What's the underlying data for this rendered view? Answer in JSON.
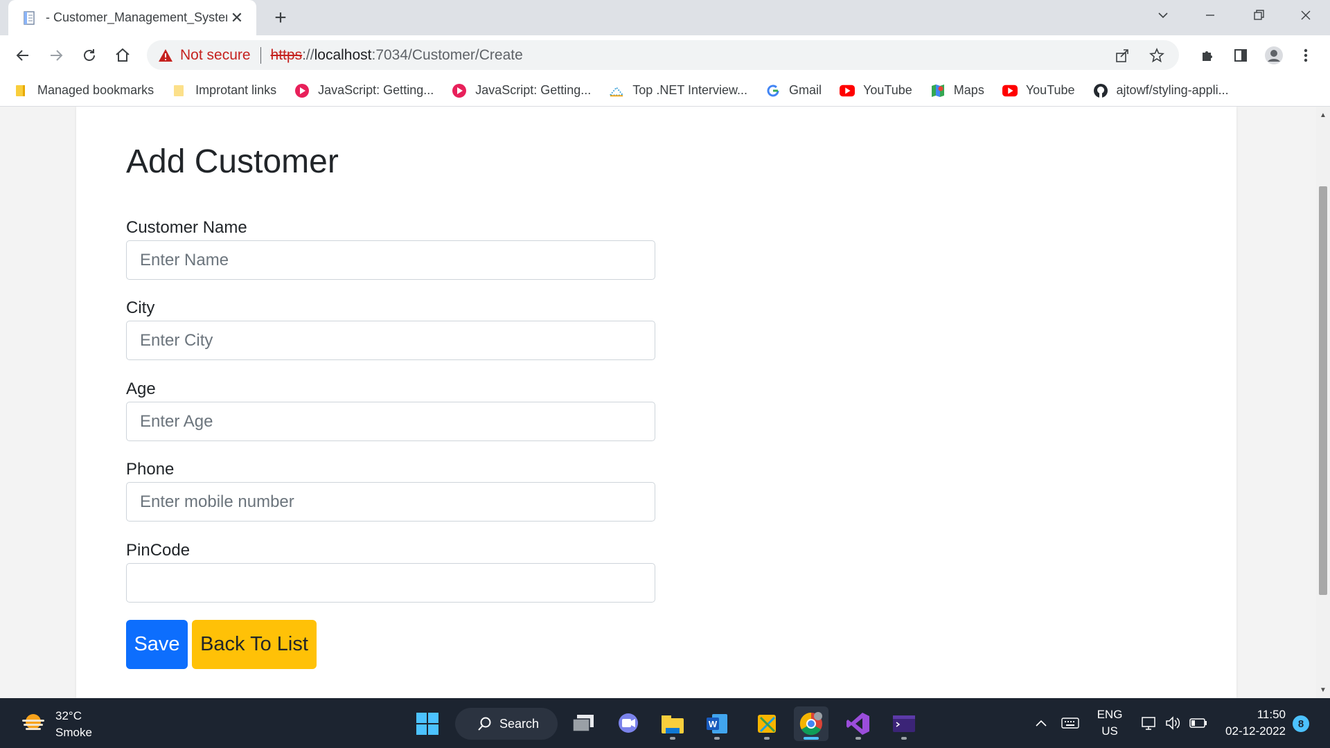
{
  "browser": {
    "tab_title": "- Customer_Management_System",
    "new_tab_label": "+",
    "close_tab_label": "✕",
    "security_label": "Not secure",
    "url_scheme": "https",
    "url_separator": "://",
    "url_host": "localhost",
    "url_path": ":7034/Customer/Create",
    "bookmarks": [
      {
        "label": "Managed bookmarks",
        "icon": "folder-icon"
      },
      {
        "label": "Improtant links",
        "icon": "folder-icon"
      },
      {
        "label": "JavaScript: Getting...",
        "icon": "play-circle-icon"
      },
      {
        "label": "JavaScript: Getting...",
        "icon": "play-circle-icon"
      },
      {
        "label": "Top .NET Interview...",
        "icon": "site-icon"
      },
      {
        "label": "Gmail",
        "icon": "google-icon"
      },
      {
        "label": "YouTube",
        "icon": "youtube-icon"
      },
      {
        "label": "Maps",
        "icon": "maps-icon"
      },
      {
        "label": "YouTube",
        "icon": "youtube-icon"
      },
      {
        "label": "ajtowf/styling-appli...",
        "icon": "github-icon"
      }
    ]
  },
  "form": {
    "title": "Add Customer",
    "fields": [
      {
        "label": "Customer Name",
        "placeholder": "Enter Name",
        "value": ""
      },
      {
        "label": "City",
        "placeholder": "Enter City",
        "value": ""
      },
      {
        "label": "Age",
        "placeholder": "Enter Age",
        "value": ""
      },
      {
        "label": "Phone",
        "placeholder": "Enter mobile number",
        "value": ""
      },
      {
        "label": "PinCode",
        "placeholder": "",
        "value": ""
      }
    ],
    "save_label": "Save",
    "back_label": "Back To List"
  },
  "taskbar": {
    "weather_temp": "32°C",
    "weather_desc": "Smoke",
    "search_label": "Search",
    "lang_primary": "ENG",
    "lang_secondary": "US",
    "time": "11:50",
    "date": "02-12-2022",
    "notification_count": "8"
  },
  "colors": {
    "primary": "#0d6efd",
    "warning": "#ffc107",
    "not_secure": "#c5221f"
  }
}
